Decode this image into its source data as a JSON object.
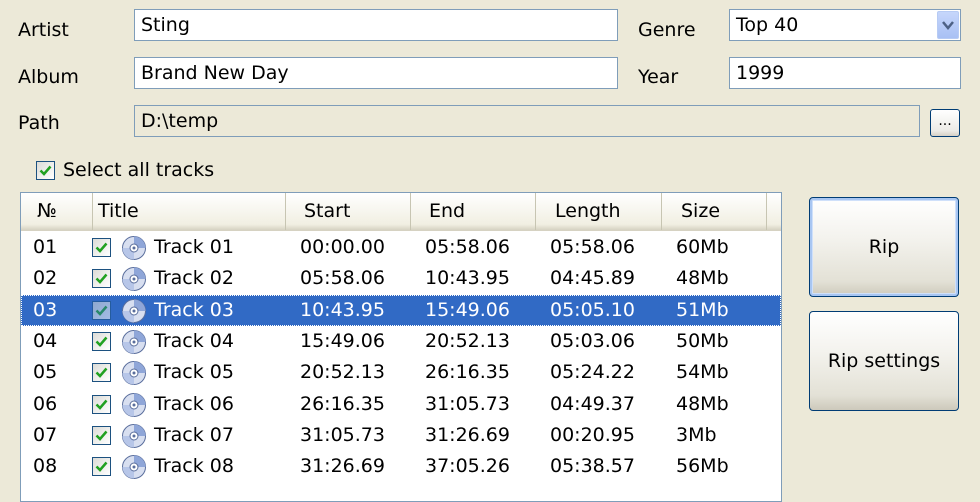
{
  "form": {
    "artist_label": "Artist",
    "artist_value": "Sting",
    "album_label": "Album",
    "album_value": "Brand New Day",
    "path_label": "Path",
    "path_value": "D:\\temp",
    "browse_label": "...",
    "genre_label": "Genre",
    "genre_value": "Top 40",
    "year_label": "Year",
    "year_value": "1999"
  },
  "select_all": {
    "label": "Select all tracks",
    "checked": true
  },
  "tracklist": {
    "columns": [
      "№",
      "Title",
      "Start",
      "End",
      "Length",
      "Size"
    ],
    "rows": [
      {
        "no": "01",
        "title": "Track 01",
        "start": "00:00.00",
        "end": "05:58.06",
        "length": "05:58.06",
        "size": "60Mb",
        "checked": true,
        "selected": false
      },
      {
        "no": "02",
        "title": "Track 02",
        "start": "05:58.06",
        "end": "10:43.95",
        "length": "04:45.89",
        "size": "48Mb",
        "checked": true,
        "selected": false
      },
      {
        "no": "03",
        "title": "Track 03",
        "start": "10:43.95",
        "end": "15:49.06",
        "length": "05:05.10",
        "size": "51Mb",
        "checked": true,
        "selected": true
      },
      {
        "no": "04",
        "title": "Track 04",
        "start": "15:49.06",
        "end": "20:52.13",
        "length": "05:03.06",
        "size": "50Mb",
        "checked": true,
        "selected": false
      },
      {
        "no": "05",
        "title": "Track 05",
        "start": "20:52.13",
        "end": "26:16.35",
        "length": "05:24.22",
        "size": "54Mb",
        "checked": true,
        "selected": false
      },
      {
        "no": "06",
        "title": "Track 06",
        "start": "26:16.35",
        "end": "31:05.73",
        "length": "04:49.37",
        "size": "48Mb",
        "checked": true,
        "selected": false
      },
      {
        "no": "07",
        "title": "Track 07",
        "start": "31:05.73",
        "end": "31:26.69",
        "length": "00:20.95",
        "size": "3Mb",
        "checked": true,
        "selected": false
      },
      {
        "no": "08",
        "title": "Track 08",
        "start": "31:26.69",
        "end": "37:05.26",
        "length": "05:38.57",
        "size": "56Mb",
        "checked": true,
        "selected": false
      }
    ]
  },
  "buttons": {
    "rip": "Rip",
    "rip_settings": "Rip settings"
  },
  "colors": {
    "selection": "#316ac5",
    "window": "#ece9d8",
    "border": "#7f9db9"
  }
}
